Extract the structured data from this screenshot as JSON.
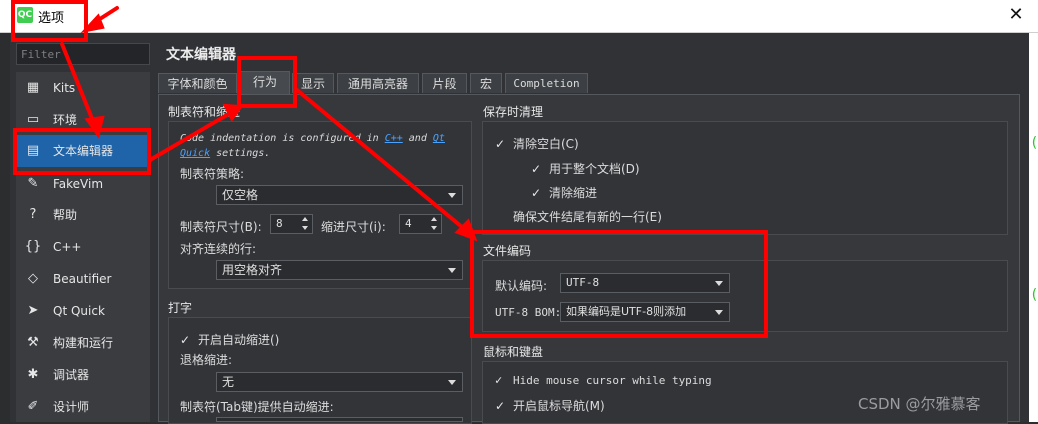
{
  "window": {
    "title": "选项",
    "logo_text": "QC",
    "close_glyph": "✕"
  },
  "filter": {
    "placeholder": "Filter"
  },
  "nav": {
    "items": [
      {
        "icon": "kits-icon",
        "glyph": "▦",
        "label": "Kits"
      },
      {
        "icon": "monitor-icon",
        "glyph": "▭",
        "label": "环境"
      },
      {
        "icon": "text-editor-icon",
        "glyph": "▤",
        "label": "文本编辑器",
        "selected": true
      },
      {
        "icon": "fakevim-icon",
        "glyph": "✎",
        "label": "FakeVim"
      },
      {
        "icon": "help-icon",
        "glyph": "?",
        "label": "帮助"
      },
      {
        "icon": "braces-icon",
        "glyph": "{}",
        "label": "C++"
      },
      {
        "icon": "diamond-icon",
        "glyph": "◇",
        "label": "Beautifier"
      },
      {
        "icon": "qtquick-icon",
        "glyph": "➤",
        "label": "Qt Quick"
      },
      {
        "icon": "hammer-icon",
        "glyph": "⚒",
        "label": "构建和运行"
      },
      {
        "icon": "bug-icon",
        "glyph": "✱",
        "label": "调试器"
      },
      {
        "icon": "pen-icon",
        "glyph": "✐",
        "label": "设计师"
      }
    ]
  },
  "page_title": "文本编辑器",
  "tabs": [
    {
      "label": "字体和颜色"
    },
    {
      "label": "行为",
      "active": true
    },
    {
      "label": "显示"
    },
    {
      "label": "通用高亮器"
    },
    {
      "label": "片段"
    },
    {
      "label": "宏"
    },
    {
      "label": "Completion"
    }
  ],
  "tabs_indent": {
    "title": "制表符和缩进",
    "note_pre": "Code indentation is configured in ",
    "note_link1": "C++",
    "note_mid": " and ",
    "note_link2": "Qt Quick",
    "note_post": " settings.",
    "tab_policy_label": "制表符策略:",
    "tab_policy_value": "仅空格",
    "tab_size_label": "制表符尺寸(B):",
    "tab_size_value": "8",
    "indent_size_label": "缩进尺寸(i):",
    "indent_size_value": "4",
    "align_label": "对齐连续的行:",
    "align_value": "用空格对齐"
  },
  "typing": {
    "title": "打字",
    "auto_indent": "开启自动缩进()",
    "backspace_label": "退格缩进:",
    "backspace_value": "无",
    "tab_key_label": "制表符(Tab键)提供自动缩进:"
  },
  "cleanup": {
    "title": "保存时清理",
    "clean_whitespace": "清除空白(C)",
    "entire_document": "用于整个文档(D)",
    "clean_indent": "清除缩进",
    "ensure_newline": "确保文件结尾有新的一行(E)"
  },
  "encoding": {
    "title": "文件编码",
    "default_label": "默认编码:",
    "default_value": "UTF-8",
    "bom_label": "UTF-8 BOM:",
    "bom_value": "如果编码是UTF-8则添加"
  },
  "mouse": {
    "title": "鼠标和键盘",
    "hide_cursor": "Hide mouse cursor while typing",
    "mouse_nav": "开启鼠标导航(M)"
  },
  "watermark": "CSDN @尔雅慕客",
  "colors": {
    "annotation_red": "#ff0000",
    "selection_blue": "#1f63a8"
  }
}
